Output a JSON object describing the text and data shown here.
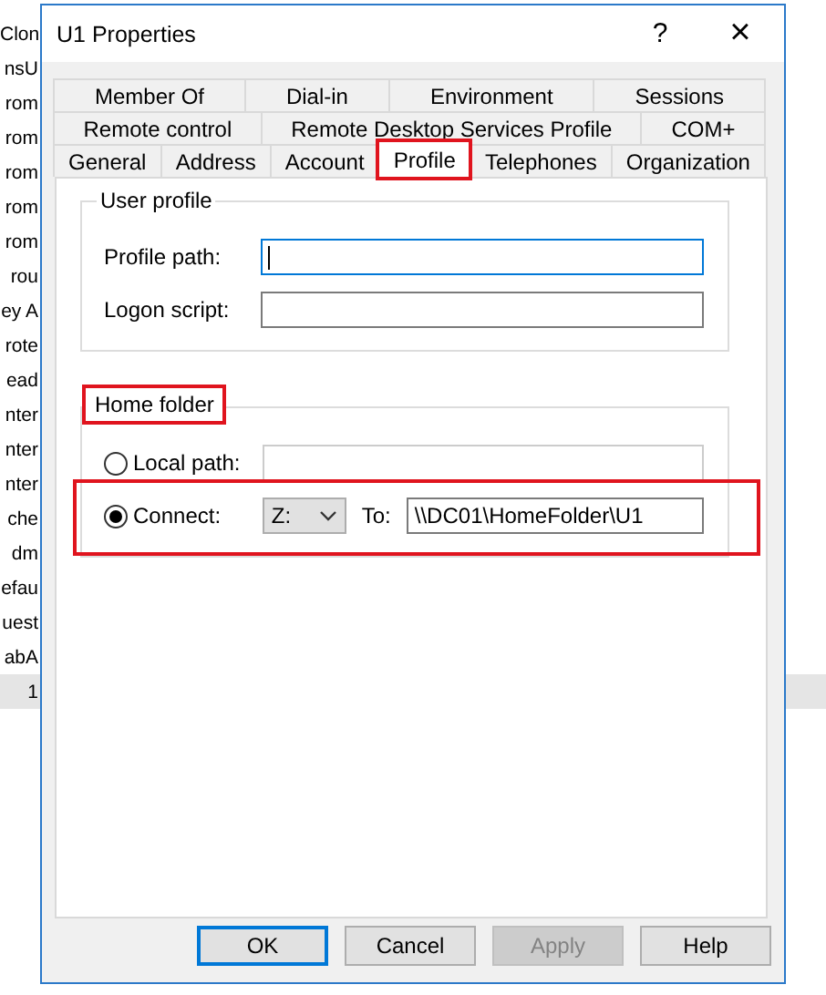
{
  "background_list": {
    "items": [
      {
        "label": "Clon",
        "selected": false
      },
      {
        "label": "nsU",
        "selected": false
      },
      {
        "label": "rom",
        "selected": false
      },
      {
        "label": "rom",
        "selected": false
      },
      {
        "label": "rom",
        "selected": false
      },
      {
        "label": "rom",
        "selected": false
      },
      {
        "label": "rom",
        "selected": false
      },
      {
        "label": "rou",
        "selected": false
      },
      {
        "label": "ey A",
        "selected": false
      },
      {
        "label": "rote",
        "selected": false
      },
      {
        "label": "ead",
        "selected": false
      },
      {
        "label": "nter",
        "selected": false
      },
      {
        "label": "nter",
        "selected": false
      },
      {
        "label": "nter",
        "selected": false
      },
      {
        "label": "che",
        "selected": false
      },
      {
        "label": "dm",
        "selected": false
      },
      {
        "label": "efau",
        "selected": false
      },
      {
        "label": "uest",
        "selected": false
      },
      {
        "label": "abA",
        "selected": false
      },
      {
        "label": "1",
        "selected": true
      }
    ]
  },
  "window": {
    "title": "U1 Properties",
    "help": "?",
    "close": "×"
  },
  "tab_rows": [
    [
      {
        "label": "Member Of",
        "selected": false,
        "highlighted": false
      },
      {
        "label": "Dial-in",
        "selected": false,
        "highlighted": false
      },
      {
        "label": "Environment",
        "selected": false,
        "highlighted": false
      },
      {
        "label": "Sessions",
        "selected": false,
        "highlighted": false
      }
    ],
    [
      {
        "label": "Remote control",
        "selected": false,
        "highlighted": false
      },
      {
        "label": "Remote Desktop Services Profile",
        "selected": false,
        "highlighted": false
      },
      {
        "label": "COM+",
        "selected": false,
        "highlighted": false
      }
    ],
    [
      {
        "label": "General",
        "selected": false,
        "highlighted": false
      },
      {
        "label": "Address",
        "selected": false,
        "highlighted": false
      },
      {
        "label": "Account",
        "selected": false,
        "highlighted": false
      },
      {
        "label": "Profile",
        "selected": true,
        "highlighted": true
      },
      {
        "label": "Telephones",
        "selected": false,
        "highlighted": false
      },
      {
        "label": "Organization",
        "selected": false,
        "highlighted": false
      }
    ]
  ],
  "user_profile": {
    "title": "User profile",
    "fields": [
      {
        "label": "Profile path:",
        "focused": true
      },
      {
        "label": "Logon script:",
        "focused": false
      }
    ]
  },
  "home_folder": {
    "title": "Home folder",
    "highlighted": true,
    "local_path": {
      "label": "Local path:",
      "selected": false
    },
    "connect": {
      "label": "Connect:",
      "selected": true,
      "highlighted": true,
      "drive": "Z:",
      "to_label": "To:",
      "path": "\\\\DC01\\HomeFolder\\U1"
    }
  },
  "buttons": [
    {
      "label": "OK",
      "default": true,
      "disabled": false
    },
    {
      "label": "Cancel",
      "default": false,
      "disabled": false
    },
    {
      "label": "Apply",
      "default": false,
      "disabled": true
    },
    {
      "label": "Help",
      "default": false,
      "disabled": false
    }
  ]
}
